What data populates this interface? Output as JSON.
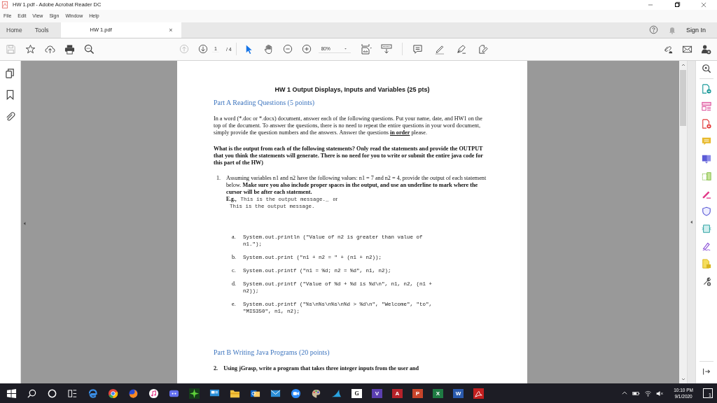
{
  "window": {
    "title": "HW 1.pdf - Adobe Acrobat Reader DC"
  },
  "menu": [
    "File",
    "Edit",
    "View",
    "Sign",
    "Window",
    "Help"
  ],
  "tabs": [
    {
      "label": "Home",
      "selected": false,
      "kind": "nav"
    },
    {
      "label": "Tools",
      "selected": false,
      "kind": "nav"
    },
    {
      "label": "HW 1.pdf",
      "selected": true,
      "kind": "document",
      "close": "×"
    }
  ],
  "account": {
    "sign_in": "Sign In"
  },
  "toolbar": {
    "save_button": {
      "disabled": true
    },
    "previous_page_button": {
      "disabled": true
    },
    "page_current": "1",
    "page_total": "/ 4",
    "select_tool": {
      "selected": true
    },
    "hand_tool": {
      "selected": false
    },
    "zoom": "80%"
  },
  "document": {
    "blocks": [
      {
        "kind": "heading",
        "text": "HW 1 Output Displays, Inputs and Variables (25 pts)"
      },
      {
        "kind": "section",
        "text": "Part A Reading Questions (5 points)"
      },
      {
        "kind": "para",
        "text": "In a word (*.doc or *.docx) document, answer each of the following questions. Put your name, date, and HW1 on the top of the document. To answer the questions, there is no need to repeat the entire questions in your word document, simply provide the question numbers and the answers. Answer the questions **in order** please."
      },
      {
        "kind": "bold-para",
        "text": "What is the output from each of the following statements? Only read the statements and provide the OUTPUT that you think the statements will generate. There is no need for you to write or submit the entire java code for this part of the HW)"
      },
      {
        "kind": "item",
        "number": "1.",
        "text": "Assuming variables n1 and n2 have the following values: n1 = 7 and n2 = 4, provide the output of each statement below. **Make sure you also include proper spaces in the output, and use an underline to mark where the cursor will be after each statement.**"
      },
      {
        "kind": "example",
        "label": "E.g.,",
        "code": "This is the output message._",
        "joiner": "or",
        "code2": "This is the output message."
      },
      {
        "kind": "code",
        "letter": "a.",
        "code": "System.out.println (\"Value of n2 is greater than value of n1.\");"
      },
      {
        "kind": "code",
        "letter": "b.",
        "code": "System.out.print (\"n1 + n2 = \" + (n1 + n2));"
      },
      {
        "kind": "code",
        "letter": "c.",
        "code": "System.out.printf (\"n1 = %d; n2 = %d\", n1, n2);"
      },
      {
        "kind": "code",
        "letter": "d.",
        "code": "System.out.printf (\"Value of %d + %d is %d\\n\", n1, n2, (n1 + n2));"
      },
      {
        "kind": "code",
        "letter": "e.",
        "code": "System.out.printf (\"%s\\n%s\\n%s\\n%d > %d\\n\", \"Welcome\", \"to\", \"MIS350\", n1, n2);"
      },
      {
        "kind": "section",
        "text": "Part B Writing Java Programs (20 points)"
      },
      {
        "kind": "bold-item",
        "number": "2.",
        "text": "Using jGrasp, write a program that takes three integer inputs from the user and"
      }
    ]
  },
  "taskbar": {
    "letters": [
      "G",
      "V",
      "A",
      "P",
      "X",
      "W"
    ],
    "time": "10:10 PM",
    "date": "9/1/2020",
    "notifications": "1"
  }
}
